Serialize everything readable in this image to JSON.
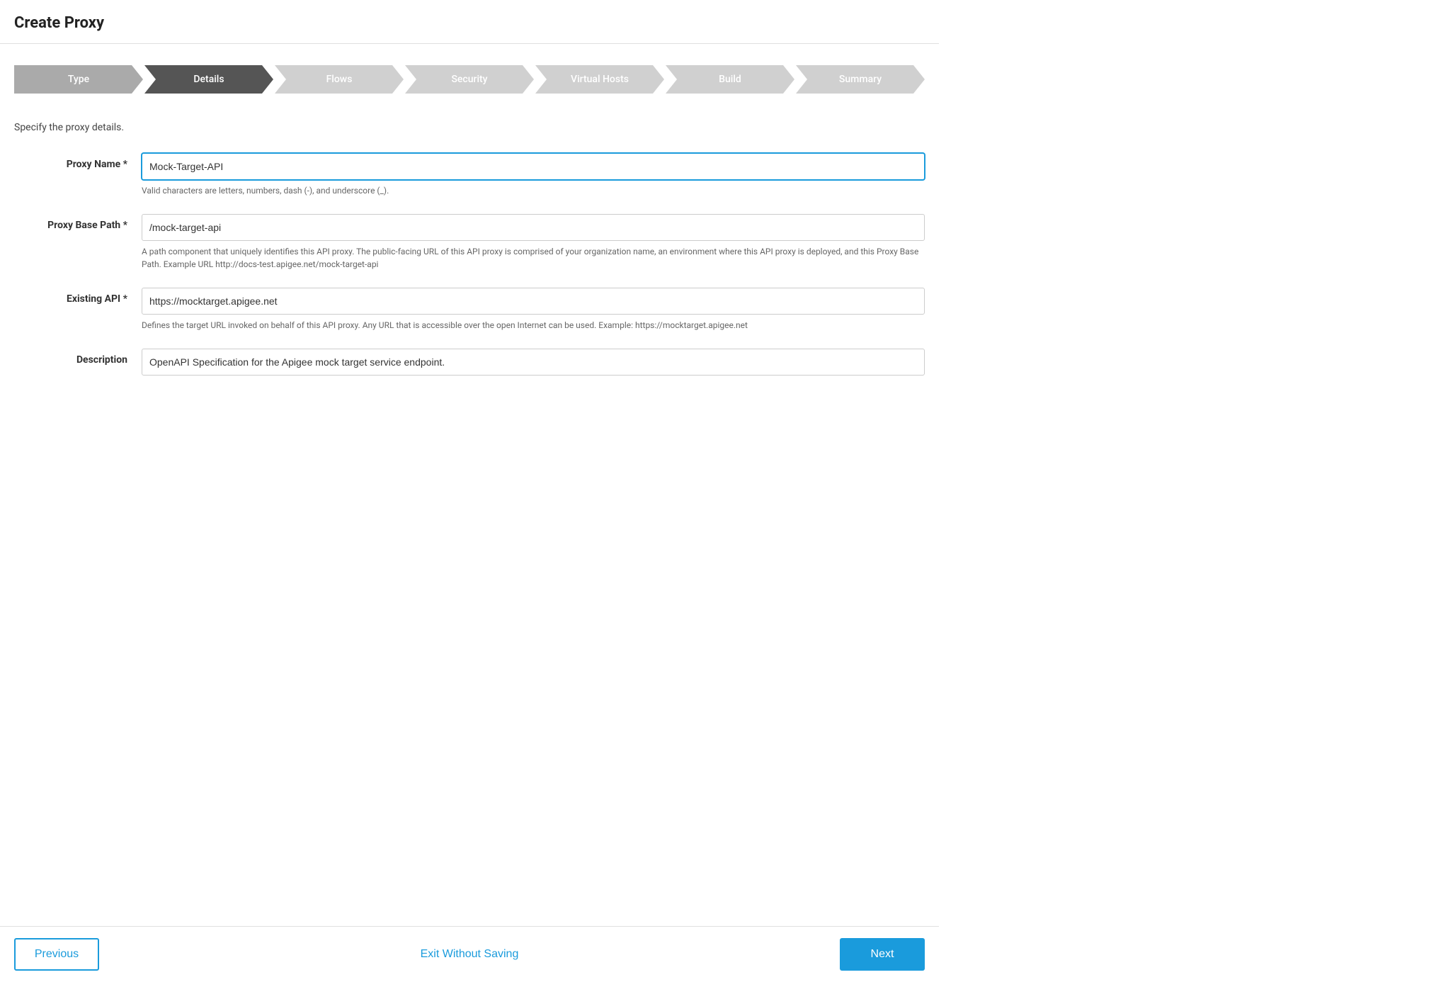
{
  "header": {
    "title": "Create Proxy"
  },
  "stepper": {
    "steps": [
      {
        "label": "Type",
        "state": "completed"
      },
      {
        "label": "Details",
        "state": "active"
      },
      {
        "label": "Flows",
        "state": "inactive"
      },
      {
        "label": "Security",
        "state": "inactive"
      },
      {
        "label": "Virtual Hosts",
        "state": "inactive"
      },
      {
        "label": "Build",
        "state": "inactive"
      },
      {
        "label": "Summary",
        "state": "inactive"
      }
    ]
  },
  "form": {
    "subtitle": "Specify the proxy details.",
    "fields": {
      "proxy_name": {
        "label": "Proxy Name",
        "required": true,
        "value": "Mock-Target-API",
        "hint": "Valid characters are letters, numbers, dash (-), and underscore (_)."
      },
      "proxy_base_path": {
        "label": "Proxy Base Path",
        "required": true,
        "value": "/mock-target-api",
        "hint": "A path component that uniquely identifies this API proxy. The public-facing URL of this API proxy is comprised of your organization name, an environment where this API proxy is deployed, and this Proxy Base Path. Example URL http://docs-test.apigee.net/mock-target-api"
      },
      "existing_api": {
        "label": "Existing API",
        "required": true,
        "value": "https://mocktarget.apigee.net",
        "hint": "Defines the target URL invoked on behalf of this API proxy. Any URL that is accessible over the open Internet can be used. Example: https://mocktarget.apigee.net"
      },
      "description": {
        "label": "Description",
        "required": false,
        "value": "OpenAPI Specification for the Apigee mock target service endpoint.",
        "hint": ""
      }
    }
  },
  "footer": {
    "previous_label": "Previous",
    "exit_label": "Exit Without Saving",
    "next_label": "Next"
  }
}
